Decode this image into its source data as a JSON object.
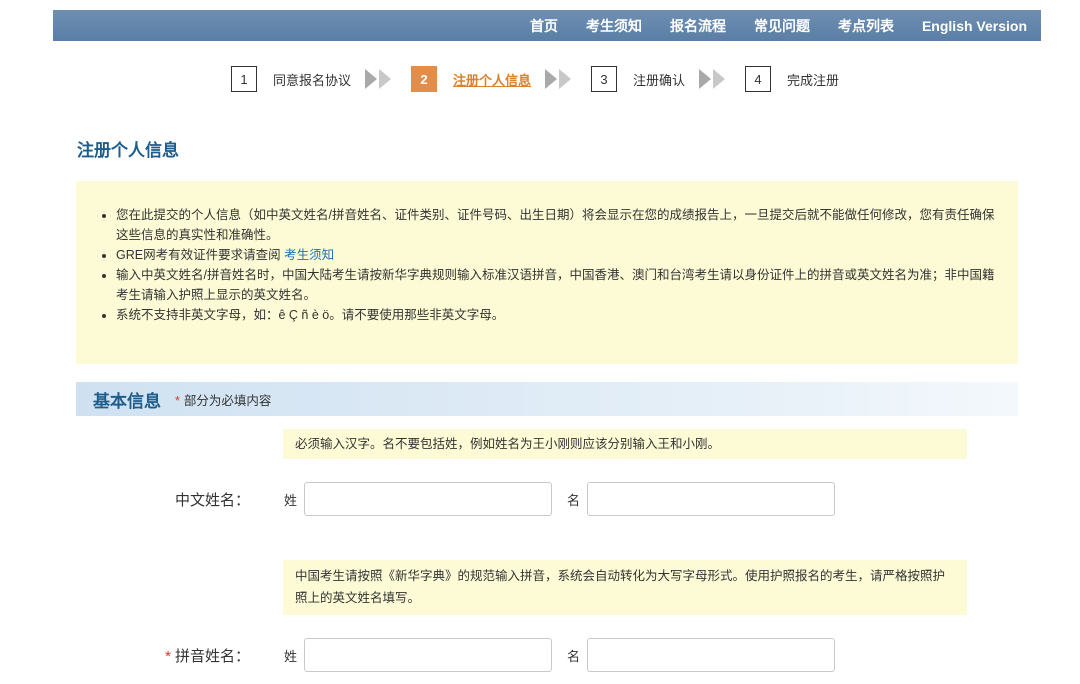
{
  "nav": {
    "items": [
      "首页",
      "考生须知",
      "报名流程",
      "常见问题",
      "考点列表",
      "English Version"
    ]
  },
  "steps": [
    {
      "num": "1",
      "label": "同意报名协议"
    },
    {
      "num": "2",
      "label": "注册个人信息"
    },
    {
      "num": "3",
      "label": "注册确认"
    },
    {
      "num": "4",
      "label": "完成注册"
    }
  ],
  "page_title": "注册个人信息",
  "notice": {
    "item1": "您在此提交的个人信息（如中英文姓名/拼音姓名、证件类别、证件号码、出生日期）将会显示在您的成绩报告上，一旦提交后就不能做任何修改，您有责任确保这些信息的真实性和准确性。",
    "item2_prefix": "GRE网考有效证件要求请查阅 ",
    "item2_link": "考生须知",
    "item3": "输入中英文姓名/拼音姓名时，中国大陆考生请按新华字典规则输入标准汉语拼音，中国香港、澳门和台湾考生请以身份证件上的拼音或英文姓名为准；非中国籍考生请输入护照上显示的英文姓名。",
    "item4": "系统不支持非英文字母，如：ê Ç ñ è ö。请不要使用那些非英文字母。"
  },
  "section": {
    "title": "基本信息",
    "required_mark": "*",
    "required_note": "部分为必填内容"
  },
  "chinese_name": {
    "hint": "必须输入汉字。名不要包括姓，例如姓名为王小刚则应该分别输入王和小刚。",
    "label": "中文姓名：",
    "surname_label": "姓",
    "given_label": "名",
    "surname_value": "",
    "given_value": ""
  },
  "pinyin_name": {
    "hint": "中国考生请按照《新华字典》的规范输入拼音，系统会自动转化为大写字母形式。使用护照报名的考生，请严格按照护照上的英文姓名填写。",
    "required_mark": "*",
    "label": "拼音姓名：",
    "surname_label": "姓",
    "given_label": "名",
    "surname_value": "",
    "given_value": ""
  },
  "colors": {
    "nav_bg": "#5a7ea6",
    "accent_orange": "#e38d4a",
    "title_blue": "#1e5d8c",
    "notice_bg": "#fdfbd5",
    "required_red": "#d9342b"
  }
}
